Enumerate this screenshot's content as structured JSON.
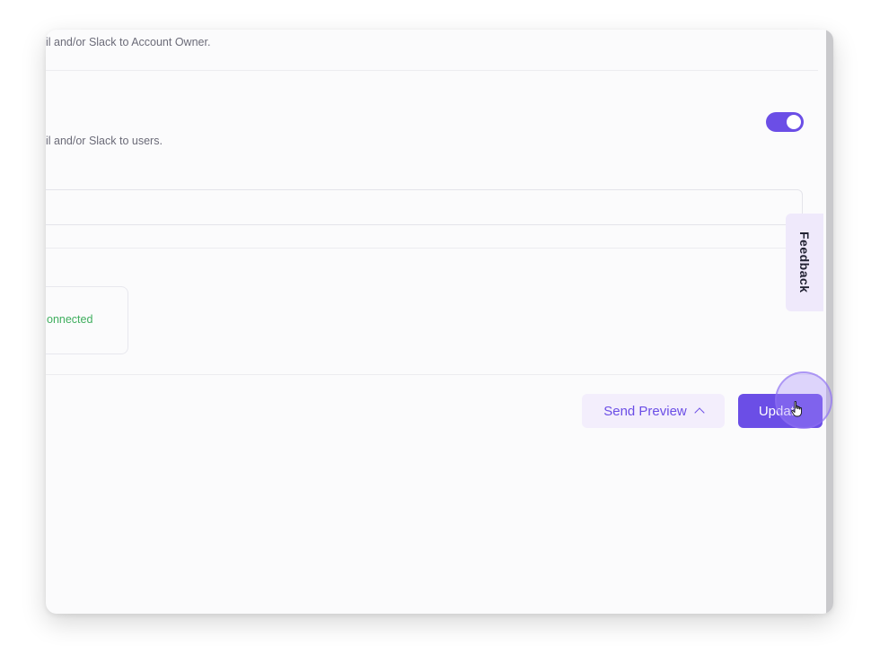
{
  "settings": {
    "account_owner_desc": "il and/or Slack to Account Owner.",
    "users_desc": "il and/or Slack to users.",
    "notify_users_enabled": true,
    "recipients_input_value": ""
  },
  "integration": {
    "status_text": "onnected"
  },
  "actions": {
    "send_preview_label": "Send Preview",
    "update_label": "Update"
  },
  "feedback": {
    "label": "Feedback"
  },
  "colors": {
    "accent": "#6b4ee6",
    "accent_light": "#f3eefc",
    "success": "#3fae5e"
  },
  "icons": {
    "send_preview_chevron": "chevron-up-icon",
    "cursor": "hand-pointer-icon"
  }
}
